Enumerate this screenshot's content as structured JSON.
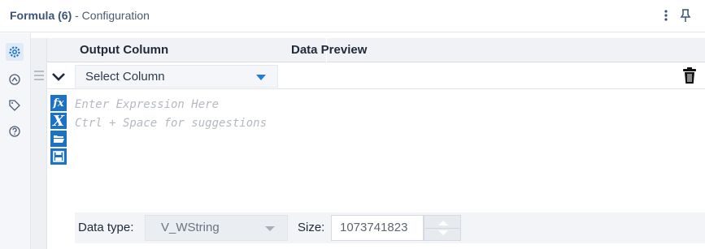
{
  "window": {
    "title": "Formula (6)",
    "subtitle": "- Configuration",
    "more_icon": "more-vertical-icon",
    "pin_icon": "pin-icon"
  },
  "rail": {
    "items": [
      {
        "icon": "gear-icon",
        "active": true
      },
      {
        "icon": "connection-icon",
        "active": false
      },
      {
        "icon": "tag-icon",
        "active": false
      },
      {
        "icon": "help-icon",
        "active": false
      }
    ]
  },
  "grid": {
    "headers": {
      "output_column": "Output Column",
      "data_preview": "Data Preview"
    },
    "row": {
      "select_column": "Select Column",
      "data_preview_value": ""
    }
  },
  "expression": {
    "placeholder_line1": "Enter Expression Here",
    "placeholder_line2": "Ctrl + Space for suggestions",
    "tools": [
      {
        "icon": "fx-functions-icon",
        "label": "fx"
      },
      {
        "icon": "variables-icon",
        "label": "X"
      },
      {
        "icon": "open-folder-icon",
        "label": ""
      },
      {
        "icon": "save-icon",
        "label": ""
      }
    ]
  },
  "footer": {
    "data_type_label": "Data type:",
    "data_type_value": "V_WString",
    "size_label": "Size:",
    "size_value": "1073741823"
  },
  "colors": {
    "title": "#3b5475",
    "accent": "#1c73c6",
    "select_arrow": "#1f7fd3",
    "placeholder": "#b4b9c1"
  }
}
